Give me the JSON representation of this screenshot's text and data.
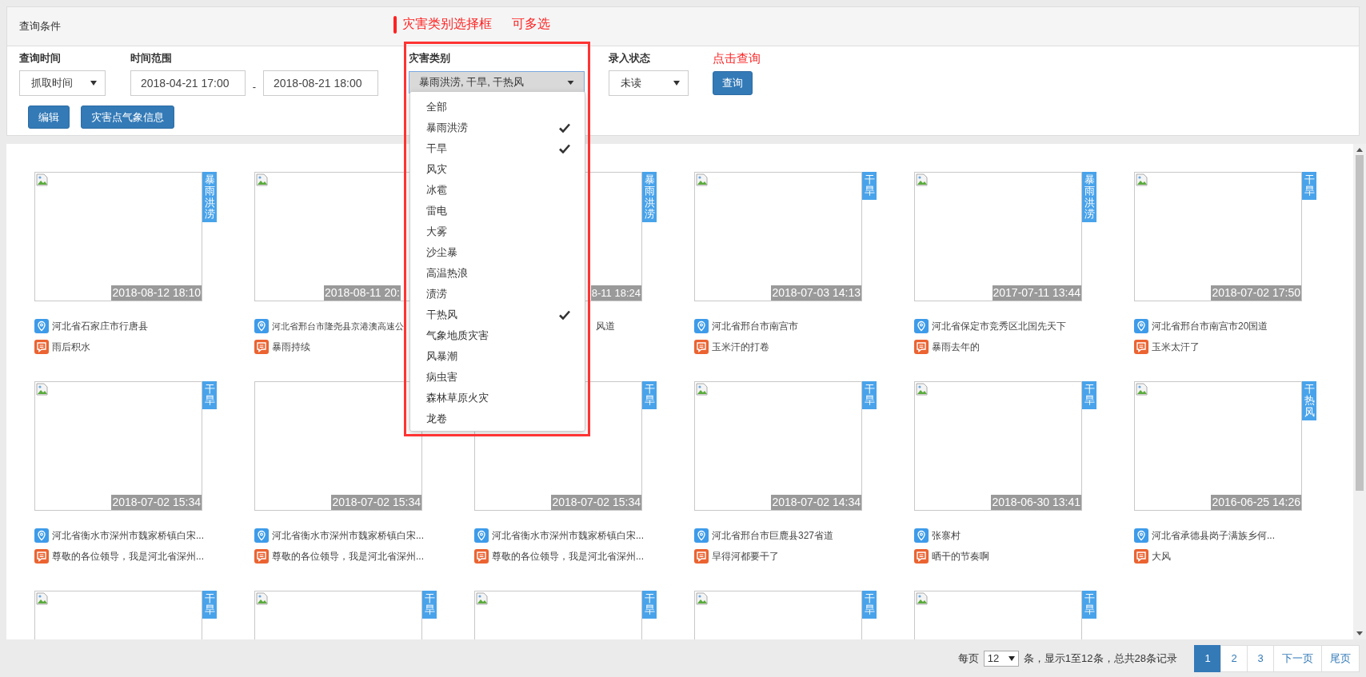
{
  "annotation": {
    "title": "灾害类别选择框",
    "note": "可多选"
  },
  "panel": {
    "title": "查询条件"
  },
  "filters": {
    "time_field": {
      "label": "查询时间",
      "value": "抓取时间"
    },
    "range": {
      "label": "时间范围",
      "from": "2018-04-21 17:00",
      "separator": "-",
      "to": "2018-08-21 18:00"
    },
    "category": {
      "label": "灾害类别",
      "value": "暴雨洪涝, 干旱, 干热风",
      "expanded": true,
      "options": [
        {
          "label": "全部",
          "checked": false
        },
        {
          "label": "暴雨洪涝",
          "checked": true
        },
        {
          "label": "干旱",
          "checked": true
        },
        {
          "label": "风灾",
          "checked": false
        },
        {
          "label": "冰雹",
          "checked": false
        },
        {
          "label": "雷电",
          "checked": false
        },
        {
          "label": "大雾",
          "checked": false
        },
        {
          "label": "沙尘暴",
          "checked": false
        },
        {
          "label": "高温热浪",
          "checked": false
        },
        {
          "label": "渍涝",
          "checked": false
        },
        {
          "label": "干热风",
          "checked": true
        },
        {
          "label": "气象地质灾害",
          "checked": false
        },
        {
          "label": "风暴潮",
          "checked": false
        },
        {
          "label": "病虫害",
          "checked": false
        },
        {
          "label": "森林草原火灾",
          "checked": false
        },
        {
          "label": "龙卷",
          "checked": false
        }
      ]
    },
    "status": {
      "label": "录入状态",
      "value": "未读"
    },
    "query_hint": "点击查询",
    "query_button": "查询"
  },
  "actions": [
    "编辑",
    "灾害点气象信息"
  ],
  "cards": [
    {
      "kind": "full",
      "badge": "暴雨洪涝",
      "date": "2018-08-12 18:10",
      "location": "河北省石家庄市行唐县",
      "note": "雨后积水"
    },
    {
      "kind": "menu-right",
      "date": "2018-08-11 20:",
      "location": "河北省邢台市隆尧县京港澳高速公",
      "note": "暴雨持续"
    },
    {
      "kind": "menu-left",
      "badge": "暴雨洪涝",
      "date": "8-11 18:24",
      "location": "风道"
    },
    {
      "kind": "full",
      "badge": "干旱",
      "date": "2018-07-03 14:13",
      "location": "河北省邢台市南宫市",
      "note": "玉米汗的打卷"
    },
    {
      "kind": "full",
      "badge": "暴雨洪涝",
      "date": "2017-07-11 13:44",
      "location": "河北省保定市竞秀区北国先天下",
      "note": "暴雨去年的"
    },
    {
      "kind": "full",
      "badge": "干旱",
      "date": "2018-07-02 17:50",
      "location": "河北省邢台市南宫市20国道",
      "note": "玉米太汗了"
    },
    {
      "kind": "full",
      "badge": "干旱",
      "date": "2018-07-02 15:34",
      "location": "河北省衡水市深州市魏家桥镇白宋...",
      "note": "尊敬的各位领导，我是河北省深州..."
    },
    {
      "kind": "menu-top",
      "date": "2018-07-02 15:34",
      "location": "河北省衡水市深州市魏家桥镇白宋...",
      "note": "尊敬的各位领导，我是河北省深州..."
    },
    {
      "kind": "menu-top",
      "badge": "干旱",
      "date": "2018-07-02 15:34",
      "location": "河北省衡水市深州市魏家桥镇白宋...",
      "note": "尊敬的各位领导，我是河北省深州..."
    },
    {
      "kind": "full",
      "badge": "干旱",
      "date": "2018-07-02 14:34",
      "location": "河北省邢台市巨鹿县327省道",
      "note": "旱得河都要干了"
    },
    {
      "kind": "full",
      "badge": "干旱",
      "date": "2018-06-30 13:41",
      "location": "张寨村",
      "note": "晒干的节奏啊"
    },
    {
      "kind": "full",
      "badge": "干热风",
      "date": "2016-06-25 14:26",
      "location": "河北省承德县岗子满族乡何...",
      "note": "大风"
    },
    {
      "kind": "full",
      "badge": "干旱"
    },
    {
      "kind": "full",
      "badge": "干旱"
    },
    {
      "kind": "full",
      "badge": "干旱"
    },
    {
      "kind": "full",
      "badge": "干旱"
    },
    {
      "kind": "full",
      "badge": "干旱"
    }
  ],
  "pagination": {
    "per_page_label": "每页",
    "per_page": "12",
    "summary": "条，显示1至12条，总共28条记录",
    "pages": [
      {
        "label": "1",
        "selected": true
      },
      {
        "label": "2",
        "selected": false
      },
      {
        "label": "3",
        "selected": false
      },
      {
        "label": "下一页",
        "selected": false
      },
      {
        "label": "尾页",
        "selected": false
      }
    ]
  }
}
